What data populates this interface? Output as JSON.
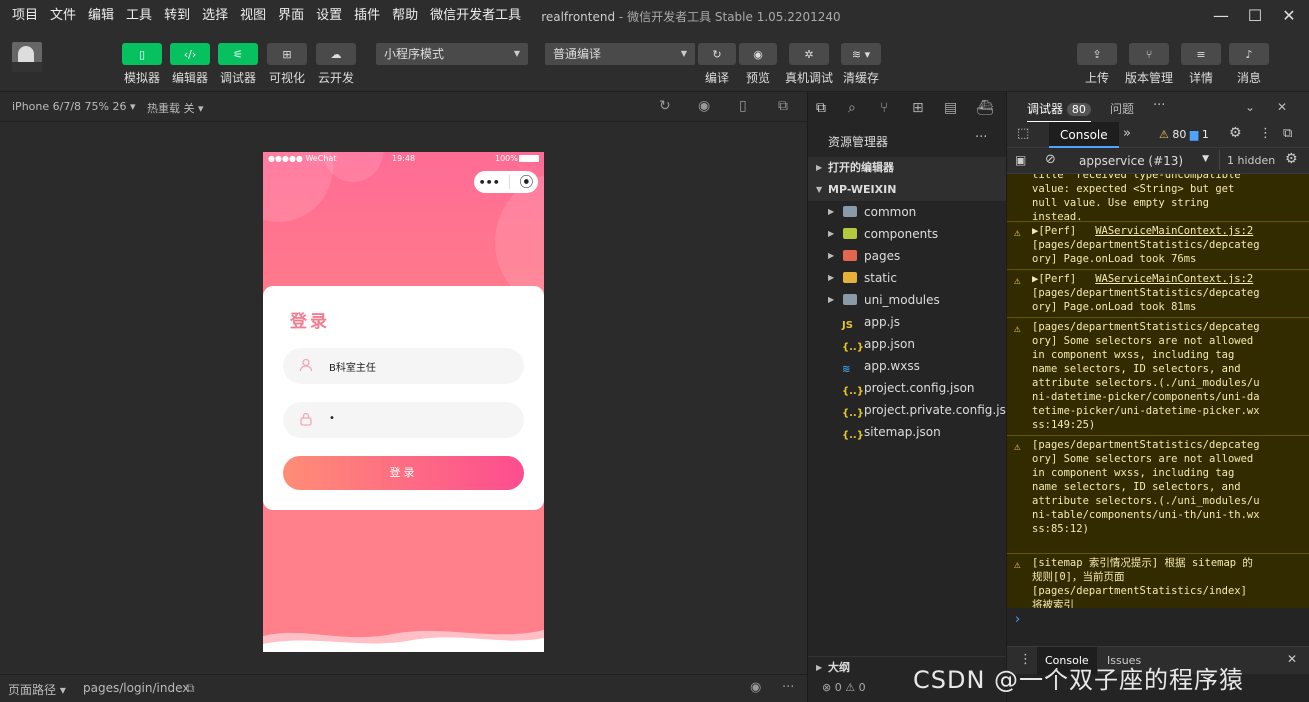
{
  "menu": {
    "items": [
      "项目",
      "文件",
      "编辑",
      "工具",
      "转到",
      "选择",
      "视图",
      "界面",
      "设置",
      "插件",
      "帮助",
      "微信开发者工具"
    ],
    "project_name": "realfrontend",
    "app_title": "微信开发者工具 Stable 1.05.2201240"
  },
  "toolbar": {
    "left_buttons": [
      {
        "label": "模拟器",
        "icon": "phone-icon"
      },
      {
        "label": "编辑器",
        "icon": "code-icon"
      },
      {
        "label": "调试器",
        "icon": "debug-icon"
      },
      {
        "label": "可视化",
        "icon": "layout-icon"
      },
      {
        "label": "云开发",
        "icon": "cloud-icon"
      }
    ],
    "mode_select": "小程序模式",
    "compile_select": "普通编译",
    "mid_buttons": [
      {
        "label": "编译",
        "icon": "refresh-icon"
      },
      {
        "label": "预览",
        "icon": "eye-icon"
      },
      {
        "label": "真机调试",
        "icon": "bug-icon"
      },
      {
        "label": "清缓存",
        "icon": "layers-icon"
      }
    ],
    "right_buttons": [
      {
        "label": "上传",
        "icon": "upload-icon"
      },
      {
        "label": "版本管理",
        "icon": "branch-icon"
      },
      {
        "label": "详情",
        "icon": "menu-icon"
      },
      {
        "label": "消息",
        "icon": "bell-icon"
      }
    ],
    "accent": "#07c160"
  },
  "simulator": {
    "device": "iPhone 6/7/8 75% 26",
    "hot_reload": "热重载 关",
    "status": {
      "carrier": "●●●●● WeChat",
      "time": "19:48",
      "battery": "100%"
    },
    "capsule": {
      "dots": "•••",
      "record": "⦿"
    },
    "login": {
      "title": "登录",
      "username": "B科室主任",
      "password": "•",
      "button": "登录"
    },
    "colors": {
      "gradient_top": "#ff6c95",
      "card_title": "#f47d90",
      "btn_start": "#ff8d76",
      "btn_end": "#fd4d8f"
    }
  },
  "bottombar": {
    "page_path_label": "页面路径",
    "page_path": "pages/login/index"
  },
  "explorer": {
    "title": "资源管理器",
    "open_editors": "打开的编辑器",
    "root": "MP-WEIXIN",
    "folders": [
      {
        "name": "common",
        "color": "#8a9aa9"
      },
      {
        "name": "components",
        "color": "#b4c93d"
      },
      {
        "name": "pages",
        "color": "#e2674f"
      },
      {
        "name": "static",
        "color": "#e6b23a"
      },
      {
        "name": "uni_modules",
        "color": "#8a9aa9"
      }
    ],
    "files": [
      {
        "name": "app.js",
        "icon": "JS",
        "color": "#e6c62f"
      },
      {
        "name": "app.json",
        "icon": "{..}",
        "color": "#e6c62f"
      },
      {
        "name": "app.wxss",
        "icon": "≋",
        "color": "#3d9be9"
      },
      {
        "name": "project.config.json",
        "icon": "{..}",
        "color": "#e6c62f"
      },
      {
        "name": "project.private.config.js...",
        "icon": "{..}",
        "color": "#e6c62f"
      },
      {
        "name": "sitemap.json",
        "icon": "{..}",
        "color": "#e6c62f"
      }
    ],
    "outline": "大纲",
    "problems": "⊗ 0 ⚠ 0"
  },
  "debugger": {
    "tab_label": "调试器",
    "badge": "80",
    "issues_tab": "问题",
    "more": "···",
    "console_tab": "Console",
    "warn_count": "80",
    "info_count": "1",
    "context": "appservice (#13)",
    "hidden": "1 hidden",
    "logs": [
      {
        "text": "title\" received type-uncompatible\nvalue: expected <String> but get\nnull value. Use empty string\ninstead.",
        "warn": false
      },
      {
        "link": "WAServiceMainContext.js:2",
        "text": "[pages/departmentStatistics/depcateg\nory] Page.onLoad took 76ms",
        "prefix": "▶[Perf] "
      },
      {
        "link": "WAServiceMainContext.js:2",
        "text": "[pages/departmentStatistics/depcateg\nory] Page.onLoad took 81ms",
        "prefix": "▶[Perf] "
      },
      {
        "text": "[pages/departmentStatistics/depcateg\nory] Some selectors are not allowed\nin component wxss, including tag\nname selectors, ID selectors, and\nattribute selectors.(./uni_modules/u\nni-datetime-picker/components/uni-da\ntetime-picker/uni-datetime-picker.wx\nss:149:25)"
      },
      {
        "text": "[pages/departmentStatistics/depcateg\nory] Some selectors are not allowed\nin component wxss, including tag\nname selectors, ID selectors, and\nattribute selectors.(./uni_modules/u\nni-table/components/uni-th/uni-th.wx\nss:85:12)"
      },
      {
        "text": "[sitemap 索引情况提示] 根据 sitemap 的\n规则[0]，当前页面\n[pages/departmentStatistics/index]\n将被索引"
      }
    ],
    "drawer_console": "Console",
    "drawer_issues": "Issues"
  },
  "watermark": "CSDN @一个双子座的程序猿"
}
